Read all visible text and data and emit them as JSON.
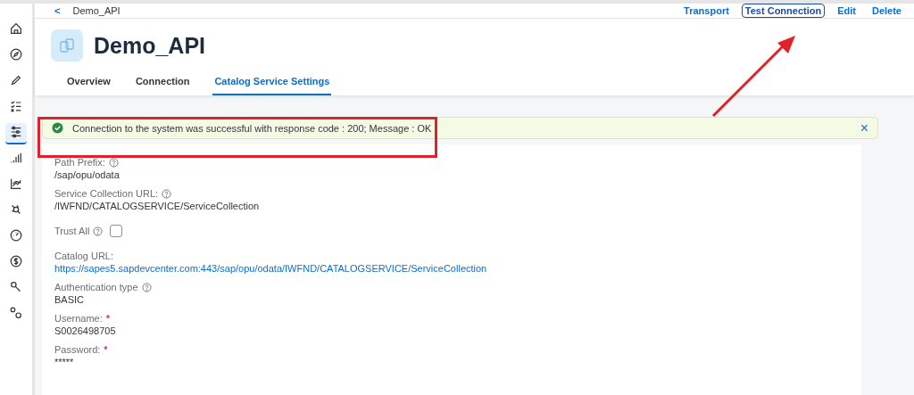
{
  "sidebar": {
    "items": [
      {
        "selected": false
      },
      {
        "selected": false
      },
      {
        "selected": false
      },
      {
        "selected": false
      },
      {
        "selected": true
      },
      {
        "selected": false
      },
      {
        "selected": false
      },
      {
        "selected": false
      },
      {
        "selected": false
      },
      {
        "selected": false
      },
      {
        "selected": false
      },
      {
        "selected": false
      }
    ]
  },
  "breadcrumb": {
    "back": "<",
    "title": "Demo_API"
  },
  "actions": [
    {
      "label": "Transport",
      "focused": false
    },
    {
      "label": "Test Connection",
      "focused": true
    },
    {
      "label": "Edit",
      "focused": false
    },
    {
      "label": "Delete",
      "focused": false
    }
  ],
  "header": {
    "title": "Demo_API"
  },
  "tabs": [
    {
      "label": "Overview",
      "selected": false
    },
    {
      "label": "Connection",
      "selected": false
    },
    {
      "label": "Catalog Service Settings",
      "selected": true
    }
  ],
  "message": {
    "text": "Connection to the system was successful with response code : 200; Message : OK",
    "close": "×"
  },
  "fields": [
    {
      "kind": "text",
      "label": "Path Prefix:",
      "help": true,
      "value": "/sap/opu/odata"
    },
    {
      "kind": "text",
      "label": "Service Collection URL:",
      "help": true,
      "value": "/IWFND/CATALOGSERVICE/ServiceCollection"
    },
    {
      "kind": "checkbox",
      "label": "Trust All",
      "help": true,
      "checked": false
    },
    {
      "kind": "link",
      "label": "Catalog URL:",
      "help": false,
      "value": "https://sapes5.sapdevcenter.com:443/sap/opu/odata/IWFND/CATALOGSERVICE/ServiceCollection"
    },
    {
      "kind": "text",
      "label": "Authentication type",
      "help": true,
      "value": "BASIC"
    },
    {
      "kind": "text",
      "label": "Username:",
      "help": false,
      "required_mark": "*",
      "value": "S0026498705"
    },
    {
      "kind": "text",
      "label": "Password:",
      "help": false,
      "required_mark": "*",
      "value": "*****"
    }
  ]
}
